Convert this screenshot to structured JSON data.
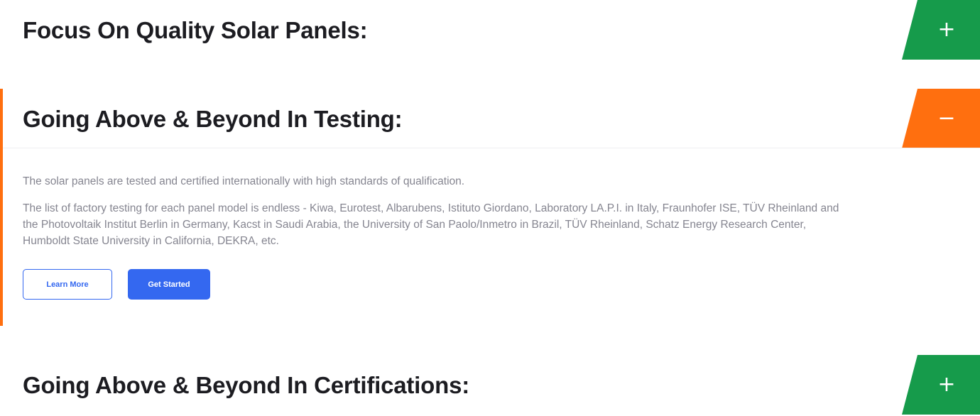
{
  "colors": {
    "green": "#169b4b",
    "orange": "#ff6f0f",
    "primary_blue": "#3468f0"
  },
  "accordion": [
    {
      "title": "Focus On Quality Solar Panels:",
      "expanded": false,
      "toggle_symbol": "+",
      "toggle_icon": "plus-icon"
    },
    {
      "title": "Going Above & Beyond In Testing:",
      "expanded": true,
      "toggle_symbol": "−",
      "toggle_icon": "minus-icon",
      "body": {
        "paragraph_1": "The solar panels are tested and certified internationally with high standards of qualification.",
        "paragraph_2": "The list of factory testing for each panel model is endless - Kiwa, Eurotest, Albarubens, Istituto Giordano, Laboratory LA.P.I. in Italy, Fraunhofer ISE, TÜV Rheinland and the Photovoltaik Institut Berlin in Germany, Kacst in Saudi Arabia, the University of San Paolo/Inmetro in Brazil, TÜV Rheinland, Schatz Energy Research Center, Humboldt State University in California, DEKRA, etc.",
        "learn_more_label": "Learn More",
        "get_started_label": "Get Started"
      }
    },
    {
      "title": "Going Above & Beyond In Certifications:",
      "expanded": false,
      "toggle_symbol": "+",
      "toggle_icon": "plus-icon"
    }
  ]
}
